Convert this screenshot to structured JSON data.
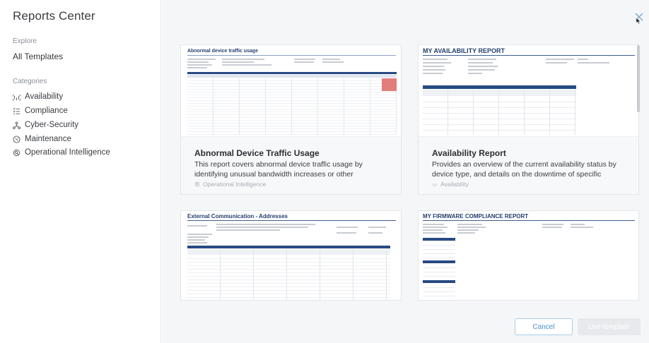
{
  "sidebar": {
    "app_title": "Reports Center",
    "explore_label": "Explore",
    "all_templates": "All Templates",
    "categories_label": "Categories",
    "categories": [
      {
        "label": "Availability",
        "icon": "signal-icon"
      },
      {
        "label": "Compliance",
        "icon": "checklist-icon"
      },
      {
        "label": "Cyber-Security",
        "icon": "network-icon"
      },
      {
        "label": "Maintenance",
        "icon": "wrench-circle-icon"
      },
      {
        "label": "Operational Intelligence",
        "icon": "gear-search-icon"
      }
    ]
  },
  "cards": [
    {
      "title": "Abnormal Device Traffic Usage",
      "description": "This report covers abnormal device traffic usage by identifying unusual bandwidth increases or other",
      "tag": "Operational Intelligence",
      "thumb_title": "Abnormal device traffic usage"
    },
    {
      "title": "Availability Report",
      "description": "Provides an overview of the current availability status by device type, and details on the downtime of specific",
      "tag": "Availability",
      "thumb_title": "MY AVAILABILITY REPORT"
    },
    {
      "thumb_title": "External Communication - Addresses"
    },
    {
      "thumb_title": "MY FIRMWARE COMPLIANCE REPORT"
    }
  ],
  "footer": {
    "cancel_label": "Cancel",
    "use_label": "Use template"
  },
  "colors": {
    "accent": "#4a90c9",
    "doc_blue": "#274a82",
    "highlight_red": "#d9534f"
  }
}
